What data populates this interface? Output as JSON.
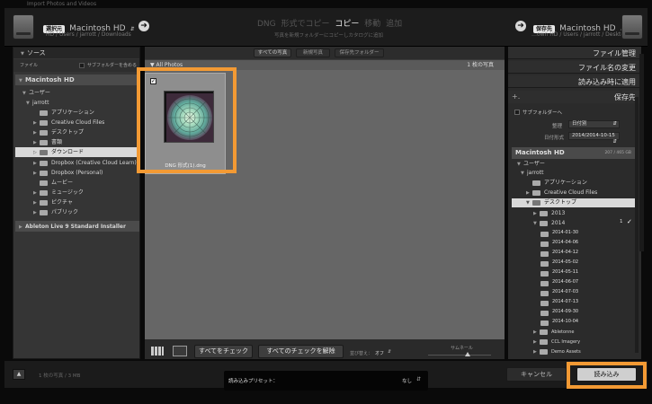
{
  "window": {
    "title": "Import Photos and Videos"
  },
  "header": {
    "source_tag": "選択元",
    "source_name": "Macintosh HD",
    "source_path": "HD / Users / jarrott / Downloads",
    "modes": [
      "DNG 形式でコピー",
      "コピー",
      "移動",
      "追加"
    ],
    "mode_active": "コピー",
    "mode_sub": "写真を新規フォルダーにコピーしカタログに追加",
    "dest_tag": "保存先",
    "dest_name": "Macintosh HD",
    "dest_path": "…own HD / Users / jarrott / Desktop"
  },
  "left": {
    "title": "ソース",
    "file_label": "ファイル",
    "subfolder_label": "サブフォルダーを含める",
    "volume": "Macintosh HD",
    "users": "ユーザー",
    "user": "jarrott",
    "folders": [
      "アプリケーション",
      "Creative Cloud Files",
      "デスクトップ",
      "書類",
      "ダウンロード",
      "Dropbox (Creative Cloud Learn)",
      "Dropbox (Personal)",
      "ムービー",
      "ミュージック",
      "ピクチャ",
      "パブリック"
    ],
    "ableton": "Ableton Live 9 Standard Installer"
  },
  "center": {
    "tabs": [
      "すべての写真",
      "新規写真",
      "保存先フォルダー"
    ],
    "grid_title": "All Photos",
    "grid_count": "1 枚の写真",
    "thumb_name": "DNG 形式(1).dng",
    "btn_check_all": "すべてをチェック",
    "btn_uncheck_all": "すべてのチェックを解除",
    "sort_label": "並び替え：",
    "sort_value": "オフ",
    "thumb_label": "サムネール"
  },
  "right": {
    "sections": [
      "ファイル管理",
      "ファイル名の変更",
      "読み込み時に適用",
      "保存先"
    ],
    "subfolder_opt": "サブフォルダーへ",
    "organize_label": "整理",
    "organize_value": "日付別",
    "date_format_label": "日付形式",
    "date_format_value": "2014/2014-10-15",
    "volume": "Macintosh HD",
    "volume_space": "207 / 465 GB",
    "users": "ユーザー",
    "user": "jarrott",
    "folders": [
      "アプリケーション",
      "Creative Cloud Files",
      "デスクトップ",
      "2013",
      "2014"
    ],
    "count_2014": "1",
    "dates": [
      "2014-01-30",
      "2014-04-06",
      "2014-04-12",
      "2014-05-02",
      "2014-05-11",
      "2014-06-07",
      "2014-07-03",
      "2014-07-13",
      "2014-09-30",
      "2014-10-04"
    ],
    "bottom_folders": [
      "Abletonne",
      "CCL Imagery",
      "Demo Assets"
    ]
  },
  "footer": {
    "summary": "1 枚の写真 / 3 MB",
    "preset_label": "読み込みプリセット：",
    "preset_value": "なし",
    "cancel": "キャンセル",
    "import": "読み込み"
  },
  "colors": {
    "highlight": "#f39a34"
  }
}
